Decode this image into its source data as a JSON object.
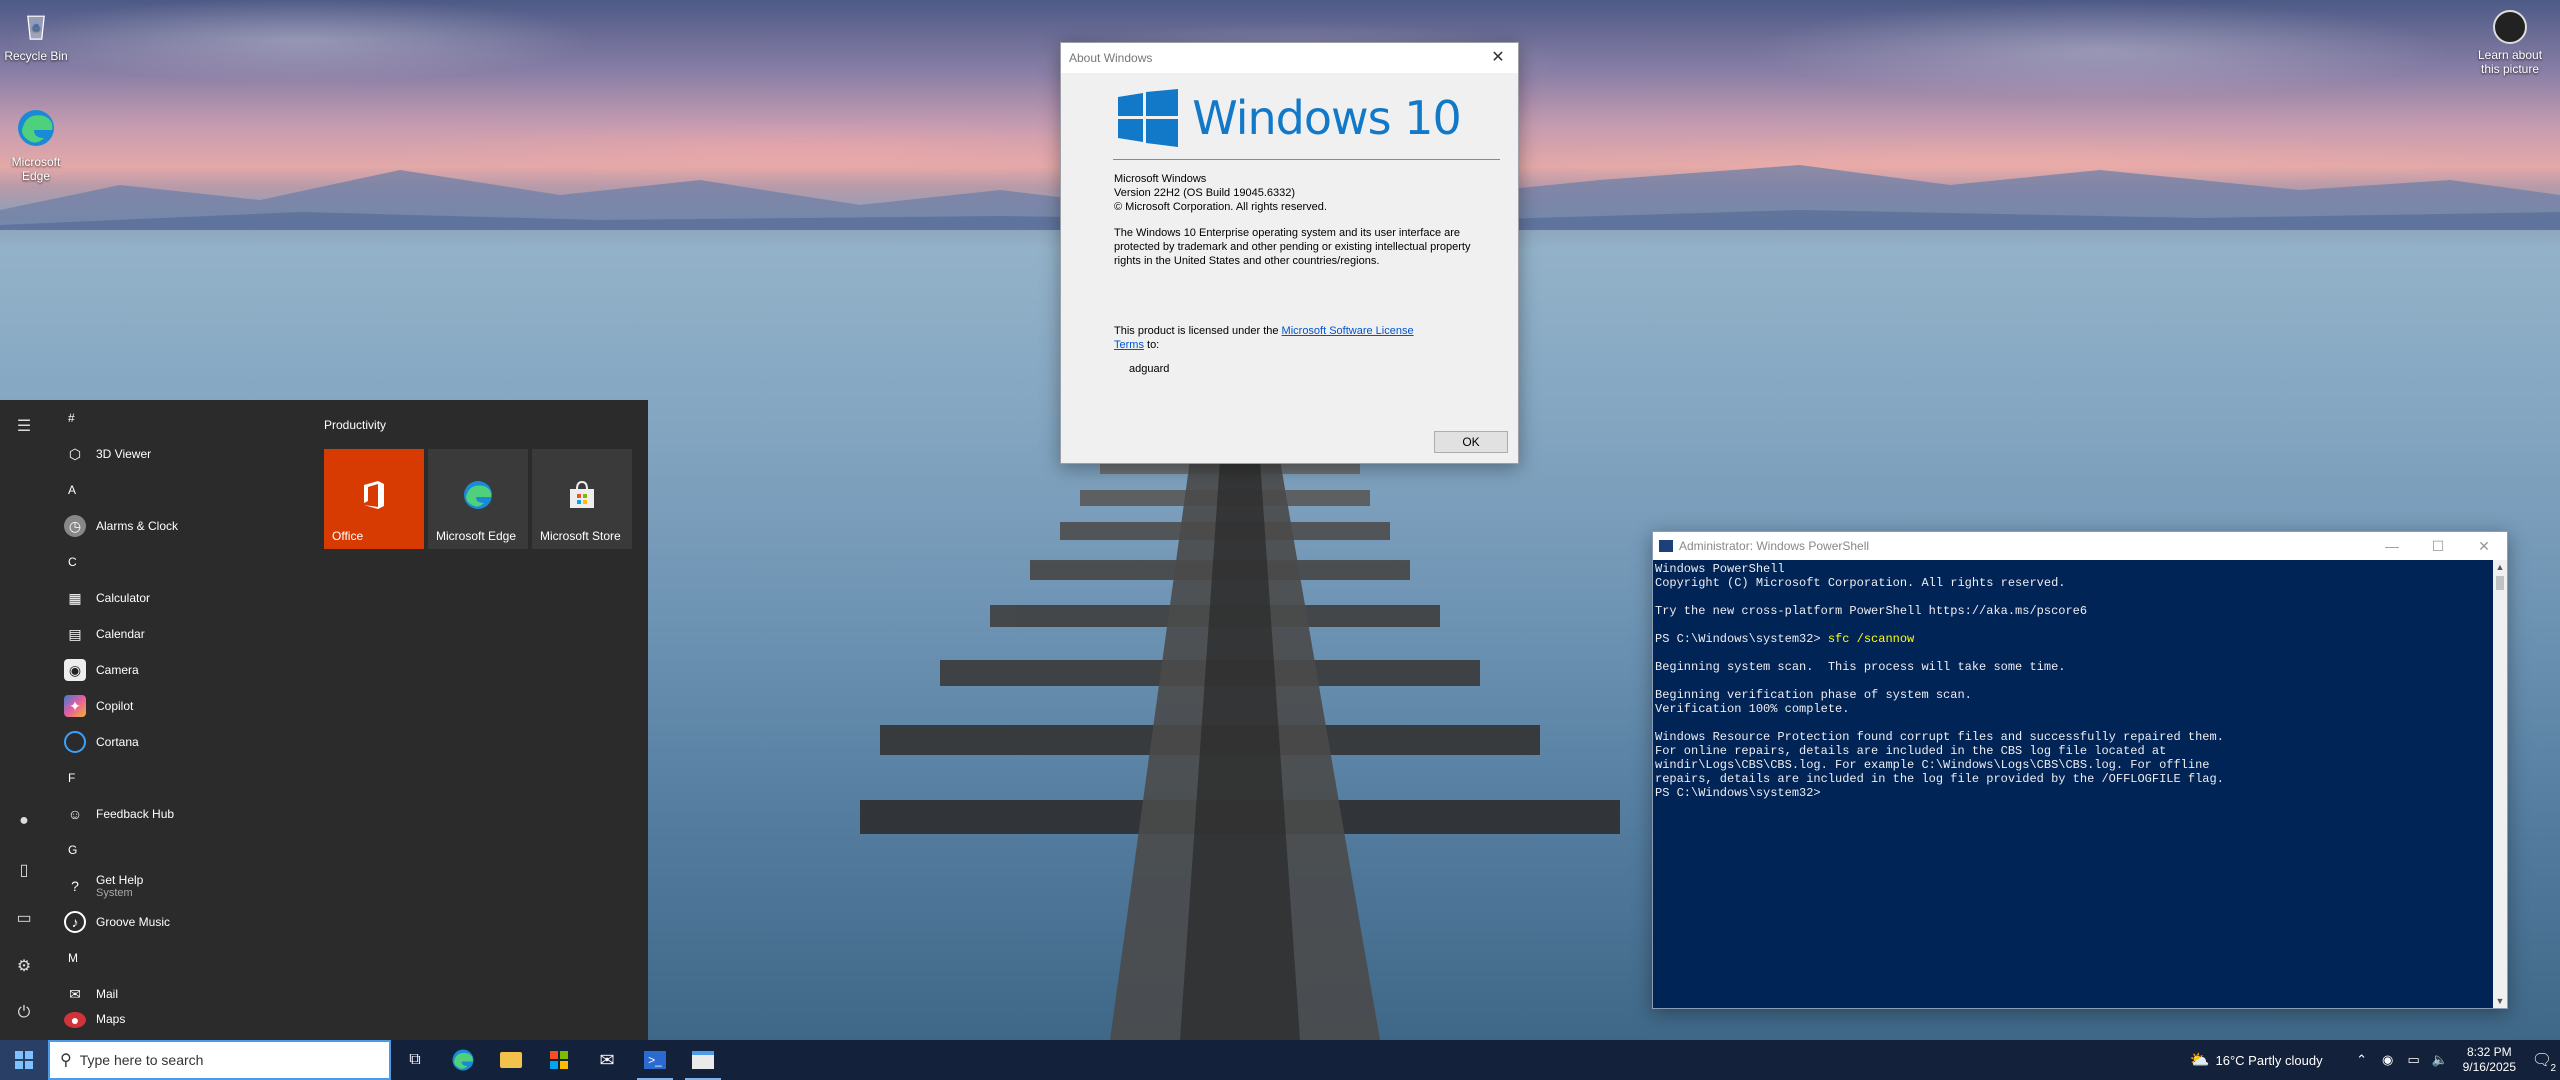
{
  "desktop": {
    "icons": [
      {
        "label": "Recycle Bin"
      },
      {
        "label": "Microsoft Edge"
      }
    ],
    "learn_picture": "Learn about this picture"
  },
  "about_dialog": {
    "title": "About Windows",
    "logo_text": "Windows 10",
    "product": "Microsoft Windows",
    "version": "Version 22H2 (OS Build 19045.6332)",
    "copyright": "© Microsoft Corporation. All rights reserved.",
    "legal": "The Windows 10 Enterprise operating system and its user interface are protected by trademark and other pending or existing intellectual property rights in the United States and other countries/regions.",
    "license_prefix": "This product is licensed under the ",
    "license_link": "Microsoft Software License Terms",
    "license_suffix": " to:",
    "licensee": "adguard",
    "ok_label": "OK"
  },
  "powershell": {
    "title": "Administrator: Windows PowerShell",
    "lines": [
      "Windows PowerShell",
      "Copyright (C) Microsoft Corporation. All rights reserved.",
      "",
      "Try the new cross-platform PowerShell https://aka.ms/pscore6",
      "",
      "PS C:\\Windows\\system32> ",
      "",
      "Beginning system scan.  This process will take some time.",
      "",
      "Beginning verification phase of system scan.",
      "Verification 100% complete.",
      "",
      "Windows Resource Protection found corrupt files and successfully repaired them.",
      "For online repairs, details are included in the CBS log file located at",
      "windir\\Logs\\CBS\\CBS.log. For example C:\\Windows\\Logs\\CBS\\CBS.log. For offline",
      "repairs, details are included in the log file provided by the /OFFLOGFILE flag.",
      "PS C:\\Windows\\system32>"
    ],
    "command": "sfc /scannow"
  },
  "start_menu": {
    "sections": [
      {
        "letter": "#",
        "apps": [
          {
            "label": "3D Viewer",
            "icon": "cube-icon",
            "sub": ""
          }
        ]
      },
      {
        "letter": "A",
        "apps": [
          {
            "label": "Alarms & Clock",
            "icon": "clock-icon",
            "sub": ""
          }
        ]
      },
      {
        "letter": "C",
        "apps": [
          {
            "label": "Calculator",
            "icon": "calculator-icon",
            "sub": ""
          },
          {
            "label": "Calendar",
            "icon": "calendar-icon",
            "sub": ""
          },
          {
            "label": "Camera",
            "icon": "camera-icon",
            "sub": ""
          },
          {
            "label": "Copilot",
            "icon": "copilot-icon",
            "sub": ""
          },
          {
            "label": "Cortana",
            "icon": "cortana-icon",
            "sub": ""
          }
        ]
      },
      {
        "letter": "F",
        "apps": [
          {
            "label": "Feedback Hub",
            "icon": "feedback-icon",
            "sub": ""
          }
        ]
      },
      {
        "letter": "G",
        "apps": [
          {
            "label": "Get Help",
            "icon": "help-icon",
            "sub": "System"
          },
          {
            "label": "Groove Music",
            "icon": "music-icon",
            "sub": ""
          }
        ]
      },
      {
        "letter": "M",
        "apps": [
          {
            "label": "Mail",
            "icon": "mail-icon",
            "sub": ""
          },
          {
            "label": "Maps",
            "icon": "maps-icon",
            "sub": ""
          }
        ]
      }
    ],
    "tile_group": "Productivity",
    "tiles": [
      {
        "label": "Office",
        "color": "#d83b01"
      },
      {
        "label": "Microsoft Edge",
        "color": "#3a3a3a"
      },
      {
        "label": "Microsoft Store",
        "color": "#3a3a3a"
      }
    ]
  },
  "taskbar": {
    "search_placeholder": "Type here to search",
    "weather": "16°C  Partly cloudy",
    "time": "8:32 PM",
    "date": "9/16/2025",
    "notification_count": "2"
  }
}
